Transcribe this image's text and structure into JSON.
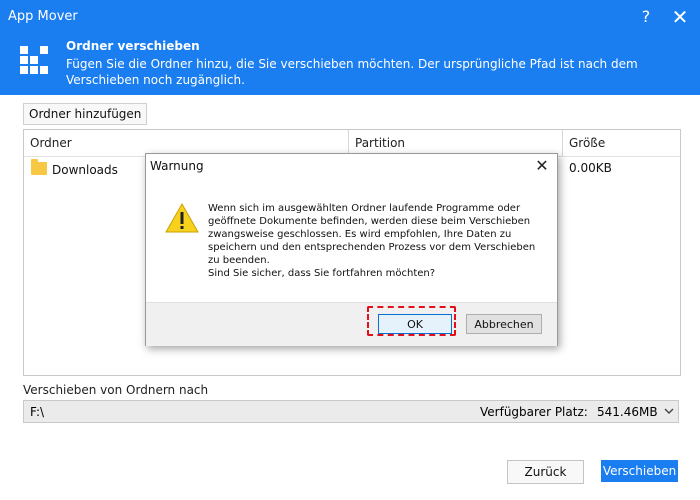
{
  "window": {
    "title": "App Mover",
    "help": "?",
    "close": "✕"
  },
  "header": {
    "heading": "Ordner verschieben",
    "description": "Fügen Sie die Ordner hinzu, die Sie verschieben möchten. Der ursprüngliche Pfad ist nach dem Verschieben noch zugänglich."
  },
  "toolbar": {
    "add_folder": "Ordner hinzufügen"
  },
  "table": {
    "columns": [
      "Ordner",
      "Partition",
      "Größe"
    ],
    "rows": [
      {
        "folder": "Downloads",
        "partition": "",
        "size": "0.00KB"
      }
    ]
  },
  "destination": {
    "label": "Verschieben von Ordnern nach",
    "path": "F:\\",
    "free_label": "Verfügbarer Platz:",
    "free_value": "541.46MB"
  },
  "footer": {
    "back": "Zurück",
    "move": "Verschieben"
  },
  "dialog": {
    "title": "Warnung",
    "close": "✕",
    "message": "Wenn sich im ausgewählten Ordner laufende Programme oder geöffnete Dokumente befinden, werden diese beim Verschieben zwangsweise geschlossen. Es wird empfohlen, Ihre Daten zu speichern und den entsprechenden Prozess vor dem Verschieben zu beenden.\nSind Sie sicher, dass Sie fortfahren möchten?",
    "ok": "OK",
    "cancel": "Abbrechen"
  },
  "colors": {
    "accent": "#1a7ef0",
    "highlight": "#e3101b",
    "warning": "#f7d11e"
  },
  "icons": [
    "app-logo-icon",
    "folder-icon",
    "chevron-down-icon",
    "warning-icon",
    "close-icon",
    "help-icon"
  ]
}
